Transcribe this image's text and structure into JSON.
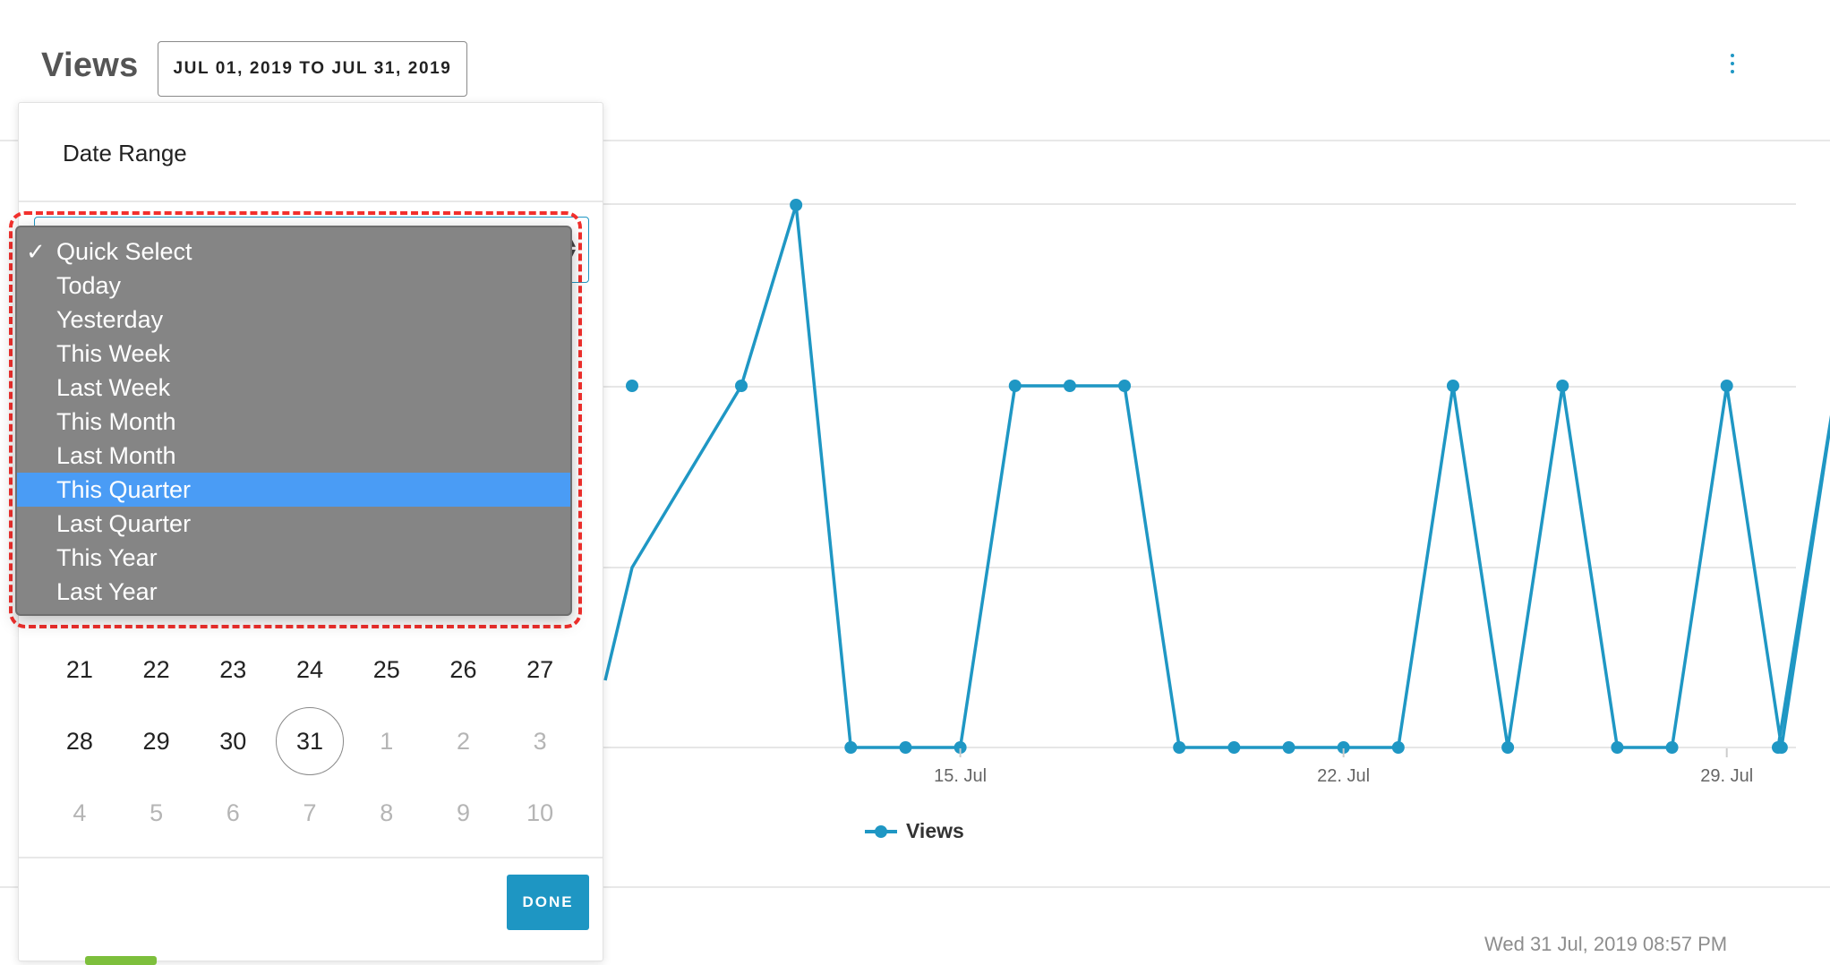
{
  "header": {
    "title": "Views",
    "date_range_button": "JUL 01, 2019 TO JUL 31, 2019",
    "menu_icon": "kebab-icon"
  },
  "popover": {
    "label": "Date Range",
    "dropdown": {
      "selected": "Quick Select",
      "highlighted": "This Quarter",
      "options": [
        "Quick Select",
        "Today",
        "Yesterday",
        "This Week",
        "Last Week",
        "This Month",
        "Last Month",
        "This Quarter",
        "Last Quarter",
        "This Year",
        "Last Year"
      ]
    },
    "calendar": {
      "rows": [
        [
          "21",
          "22",
          "23",
          "24",
          "25",
          "26",
          "27"
        ],
        [
          "28",
          "29",
          "30",
          "31",
          "1",
          "2",
          "3"
        ],
        [
          "4",
          "5",
          "6",
          "7",
          "8",
          "9",
          "10"
        ]
      ],
      "selected_day": "31"
    },
    "done_label": "DONE"
  },
  "chart_data": {
    "type": "line",
    "x_tick_labels": [
      "15. Jul",
      "22. Jul",
      "29. Jul"
    ],
    "series": [
      {
        "name": "Views",
        "color": "#1f97c4",
        "x_days": [
          11,
          12,
          13,
          14,
          15,
          16,
          17,
          18,
          19,
          20,
          21,
          22,
          23,
          24,
          25,
          26,
          27,
          28,
          29,
          30,
          31
        ],
        "values": [
          2,
          3,
          0,
          0,
          0,
          2,
          2,
          2,
          0,
          0,
          0,
          0,
          0,
          2,
          0,
          2,
          0,
          0,
          2,
          0,
          2
        ]
      }
    ],
    "legend": [
      "Views"
    ],
    "grid": true
  },
  "footer": {
    "timestamp": "Wed 31 Jul, 2019 08:57 PM"
  }
}
